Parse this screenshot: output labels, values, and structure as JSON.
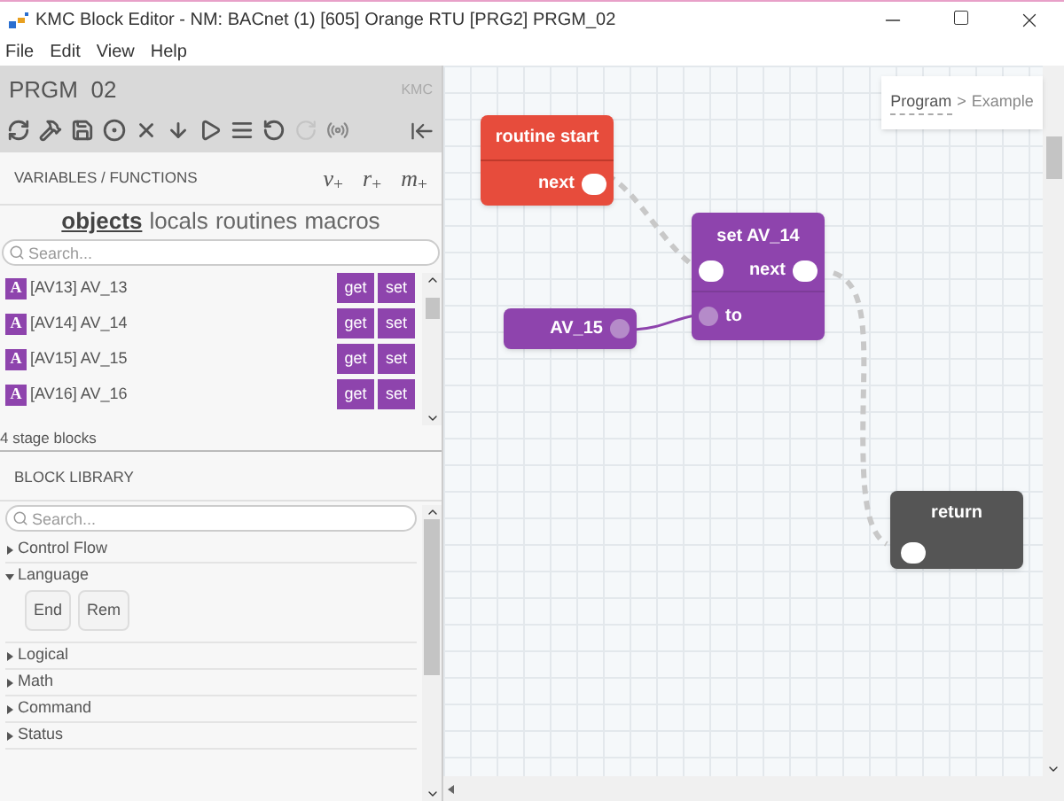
{
  "window": {
    "title": "KMC Block Editor - NM: BACnet (1) [605] Orange RTU [PRG2] PRGM_02"
  },
  "menu": [
    "File",
    "Edit",
    "View",
    "Help"
  ],
  "panel": {
    "title": "PRGM  02",
    "brand": "KMC"
  },
  "variables": {
    "title": "VARIABLES / FUNCTIONS",
    "adders": [
      "*v*$_{+}$",
      "*r*$_{+}$",
      "*m*$_{+}$"
    ],
    "tabs": [
      {
        "label": "objects",
        "selected": true
      },
      {
        "label": "locals",
        "selected": false
      },
      {
        "label": "routines",
        "selected": false
      },
      {
        "label": "macros",
        "selected": false
      }
    ],
    "search": {
      "placeholder": "Search..."
    },
    "items": [
      {
        "badge": "A",
        "label": "[AV13] AV_13",
        "actions": [
          "get",
          "set"
        ]
      },
      {
        "badge": "A",
        "label": "[AV14] AV_14",
        "actions": [
          "get",
          "set"
        ]
      },
      {
        "badge": "A",
        "label": "[AV15] AV_15",
        "actions": [
          "get",
          "set"
        ]
      },
      {
        "badge": "A",
        "label": "[AV16] AV_16",
        "actions": [
          "get",
          "set"
        ]
      }
    ],
    "status": "4 stage blocks"
  },
  "library": {
    "title": "BLOCK LIBRARY",
    "search": {
      "placeholder": "Search..."
    },
    "categories": [
      {
        "label": "Control Flow",
        "expanded": false
      },
      {
        "label": "Language",
        "expanded": true,
        "children": [
          {
            "label": "End"
          },
          {
            "label": "Rem"
          }
        ]
      },
      {
        "label": "Logical",
        "expanded": false
      },
      {
        "label": "Math",
        "expanded": false
      },
      {
        "label": "Command",
        "expanded": false
      },
      {
        "label": "Status",
        "expanded": false
      }
    ]
  },
  "canvas": {
    "breadcrumb": {
      "link": "Program",
      "separator": ">",
      "current": "Example"
    },
    "blocks": [
      {
        "kind": "start",
        "title": "routine start",
        "out": "next"
      },
      {
        "kind": "setter",
        "title": "set AV_14",
        "out": "next",
        "input": "to"
      },
      {
        "kind": "value",
        "title": "AV_15"
      },
      {
        "kind": "return",
        "title": "return"
      }
    ]
  }
}
